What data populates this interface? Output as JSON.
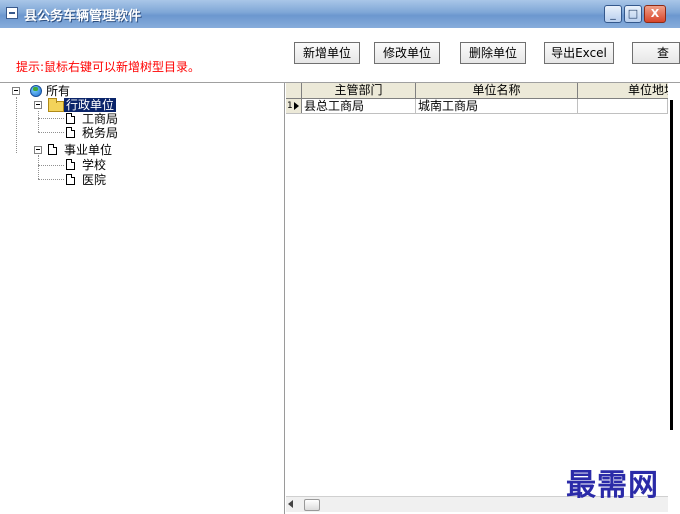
{
  "window": {
    "title": "县公务车辆管理软件",
    "minimize_glyph": "_",
    "maximize_glyph": "□",
    "close_glyph": "X"
  },
  "toolbar": {
    "hint": "提示:鼠标右键可以新增树型目录。",
    "buttons": [
      "新增单位",
      "修改单位",
      "删除单位",
      "导出Excel",
      "查"
    ]
  },
  "tree": {
    "root": "所有",
    "groups": [
      {
        "label": "行政单位",
        "selected": true,
        "children": [
          "工商局",
          "税务局"
        ]
      },
      {
        "label": "事业单位",
        "selected": false,
        "children": [
          "学校",
          "医院"
        ]
      }
    ]
  },
  "grid": {
    "columns": [
      "主管部门",
      "单位名称",
      "单位地址"
    ],
    "rows": [
      {
        "index": "1",
        "dept": "县总工商局",
        "name": "城南工商局",
        "addr": ""
      }
    ]
  },
  "watermark": "最需网",
  "colors": {
    "hint": "#ff0000",
    "selection": "#0a246a",
    "titlebar": "#7ea6d6"
  }
}
